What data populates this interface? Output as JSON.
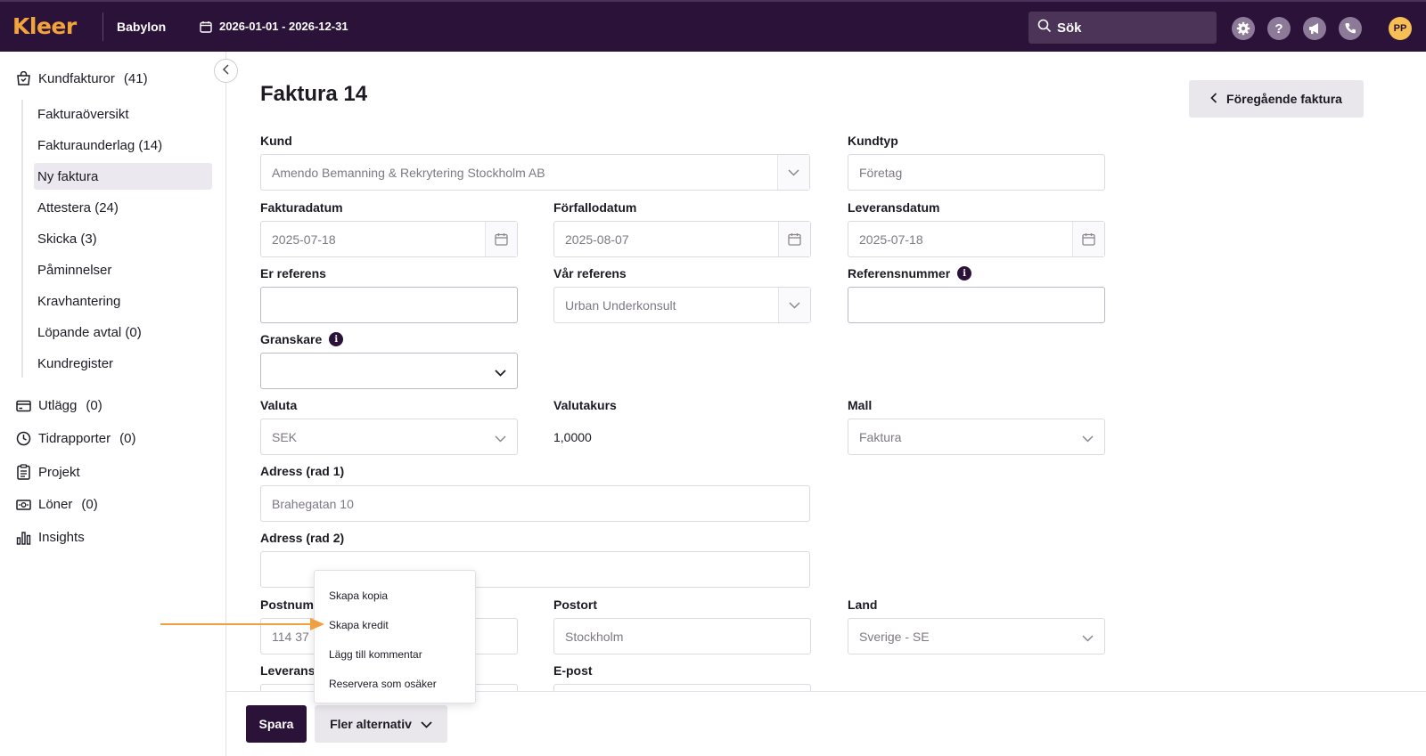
{
  "topbar": {
    "logo": "Kleer",
    "company": "Babylon",
    "period": "2026-01-01 - 2026-12-31",
    "search_placeholder": "Sök",
    "avatar": "PP",
    "icons": [
      "gear-icon",
      "help-icon",
      "megaphone-icon",
      "phone-icon"
    ],
    "colors": {
      "bar": "#2b1238",
      "logo": "#f1a33c",
      "avatar": "#f5bf55"
    }
  },
  "sidebar": {
    "main": [
      {
        "label": "Kundfakturor",
        "count": "(41)",
        "icon": "invoice-icon"
      },
      {
        "label": "Utlägg",
        "count": "(0)",
        "icon": "card-icon"
      },
      {
        "label": "Tidrapporter",
        "count": "(0)",
        "icon": "clock-icon"
      },
      {
        "label": "Projekt",
        "count": "",
        "icon": "clipboard-icon"
      },
      {
        "label": "Löner",
        "count": "(0)",
        "icon": "money-icon"
      },
      {
        "label": "Insights",
        "count": "",
        "icon": "bar-chart-icon"
      }
    ],
    "sub": [
      "Fakturaöversikt",
      "Fakturaunderlag (14)",
      "Ny faktura",
      "Attestera (24)",
      "Skicka (3)",
      "Påminnelser",
      "Kravhantering",
      "Löpande avtal (0)",
      "Kundregister"
    ],
    "active_sub": "Ny faktura"
  },
  "main": {
    "title": "Faktura 14",
    "prev_button": "Föregående faktura",
    "fields": {
      "kund": {
        "label": "Kund",
        "value": "Amendo Bemanning & Rekrytering Stockholm AB"
      },
      "kundtyp": {
        "label": "Kundtyp",
        "value": "Företag"
      },
      "fakturadatum": {
        "label": "Fakturadatum",
        "value": "2025-07-18"
      },
      "forfallodatum": {
        "label": "Förfallodatum",
        "value": "2025-08-07"
      },
      "leveransdatum": {
        "label": "Leveransdatum",
        "value": "2025-07-18"
      },
      "er_referens": {
        "label": "Er referens",
        "value": ""
      },
      "var_referens": {
        "label": "Vår referens",
        "value": "Urban Underkonsult"
      },
      "referensnummer": {
        "label": "Referensnummer",
        "value": ""
      },
      "granskare": {
        "label": "Granskare",
        "value": ""
      },
      "valuta": {
        "label": "Valuta",
        "value": "SEK"
      },
      "valutakurs": {
        "label": "Valutakurs",
        "value": "1,0000"
      },
      "mall": {
        "label": "Mall",
        "value": "Faktura"
      },
      "adress1": {
        "label": "Adress (rad 1)",
        "value": "Brahegatan 10"
      },
      "adress2": {
        "label": "Adress (rad 2)",
        "value": ""
      },
      "postnummer": {
        "label": "Postnumr",
        "value": "114 37"
      },
      "postort": {
        "label": "Postort",
        "value": "Stockholm"
      },
      "land": {
        "label": "Land",
        "value": "Sverige - SE"
      },
      "leveranssatt": {
        "label": "Leveranss",
        "value": ""
      },
      "epost": {
        "label": "E-post",
        "value": ""
      }
    }
  },
  "footer": {
    "save": "Spara",
    "more": "Fler alternativ"
  },
  "menu": {
    "items": [
      "Skapa kopia",
      "Skapa kredit",
      "Lägg till kommentar",
      "Reservera som osäker"
    ],
    "highlighted": "Skapa kredit",
    "arrow_color": "#f0a040"
  }
}
